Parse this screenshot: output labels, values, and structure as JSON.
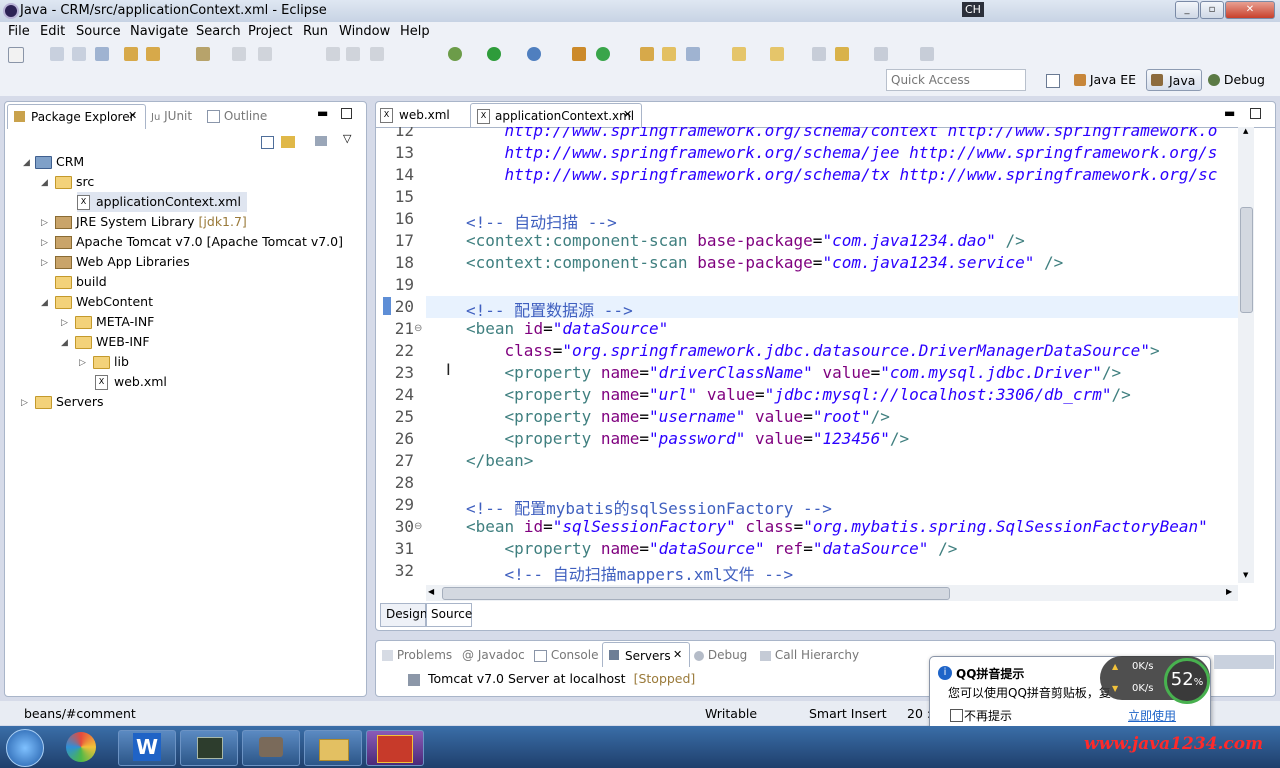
{
  "window": {
    "title": "Java - CRM/src/applicationContext.xml - Eclipse",
    "ime": "CH"
  },
  "menu": [
    "File",
    "Edit",
    "Source",
    "Navigate",
    "Search",
    "Project",
    "Run",
    "Window",
    "Help"
  ],
  "quick_access": {
    "placeholder": "Quick Access"
  },
  "perspectives": [
    "Java EE",
    "Java",
    "Debug"
  ],
  "left_tabs": [
    "Package Explorer",
    "JUnit",
    "Outline"
  ],
  "tree": [
    {
      "label": "CRM"
    },
    {
      "label": "src"
    },
    {
      "label": "applicationContext.xml"
    },
    {
      "label": "JRE System Library",
      "extra": "[jdk1.7]"
    },
    {
      "label": "Apache Tomcat v7.0 [Apache Tomcat v7.0]"
    },
    {
      "label": "Web App Libraries"
    },
    {
      "label": "build"
    },
    {
      "label": "WebContent"
    },
    {
      "label": "META-INF"
    },
    {
      "label": "WEB-INF"
    },
    {
      "label": "lib"
    },
    {
      "label": "web.xml"
    },
    {
      "label": "Servers"
    }
  ],
  "editor_tabs": [
    "web.xml",
    "applicationContext.xml"
  ],
  "editor": {
    "line_numbers": [
      "12",
      "13",
      "14",
      "15",
      "16",
      "17",
      "18",
      "19",
      "20",
      "21",
      "22",
      "23",
      "24",
      "25",
      "26",
      "27",
      "28",
      "29",
      "30",
      "31",
      "32"
    ],
    "lines": [
      "    http://www.springframework.org/schema/context http://www.springframework.o",
      "    http://www.springframework.org/schema/jee http://www.springframework.org/s",
      "    http://www.springframework.org/schema/tx http://www.springframework.org/sc",
      "",
      "<!-- 自动扫描 -->",
      "<context:component-scan base-package=\"com.java1234.dao\" />",
      "<context:component-scan base-package=\"com.java1234.service\" />",
      "",
      "<!-- 配置数据源 -->",
      "<bean id=\"dataSource\"",
      "    class=\"org.springframework.jdbc.datasource.DriverManagerDataSource\">",
      "    <property name=\"driverClassName\" value=\"com.mysql.jdbc.Driver\"/>",
      "    <property name=\"url\" value=\"jdbc:mysql://localhost:3306/db_crm\"/>",
      "    <property name=\"username\" value=\"root\"/>",
      "    <property name=\"password\" value=\"123456\"/>",
      "</bean>",
      "",
      "<!-- 配置mybatis的sqlSessionFactory -->",
      "<bean id=\"sqlSessionFactory\" class=\"org.mybatis.spring.SqlSessionFactoryBean\"",
      "    <property name=\"dataSource\" ref=\"dataSource\" />",
      "    <!-- 自动扫描mappers.xml文件 -->"
    ]
  },
  "editor_bottom_tabs": [
    "Design",
    "Source"
  ],
  "bottom_tabs": [
    "Problems",
    "Javadoc",
    "Console",
    "Servers",
    "Debug",
    "Call Hierarchy"
  ],
  "server": {
    "name": "Tomcat v7.0 Server at localhost",
    "state": "[Stopped]"
  },
  "status": {
    "path": "beans/#comment",
    "writable": "Writable",
    "mode": "Smart Insert",
    "pos": "20 :"
  },
  "popup": {
    "title": "QQ拼音提示",
    "text": "您可以使用QQ拼音剪贴板，复",
    "checkbox": "不再提示",
    "link": "立即使用"
  },
  "net_widget": {
    "percent": "52",
    "pct_sign": "%",
    "up": "0K/s",
    "down": "0K/s"
  },
  "watermark": "www.java1234.com",
  "colors": {
    "accent": "#3f5fbf",
    "tag": "#3f7f7f",
    "attr": "#7f007f",
    "value": "#2a00ff"
  }
}
